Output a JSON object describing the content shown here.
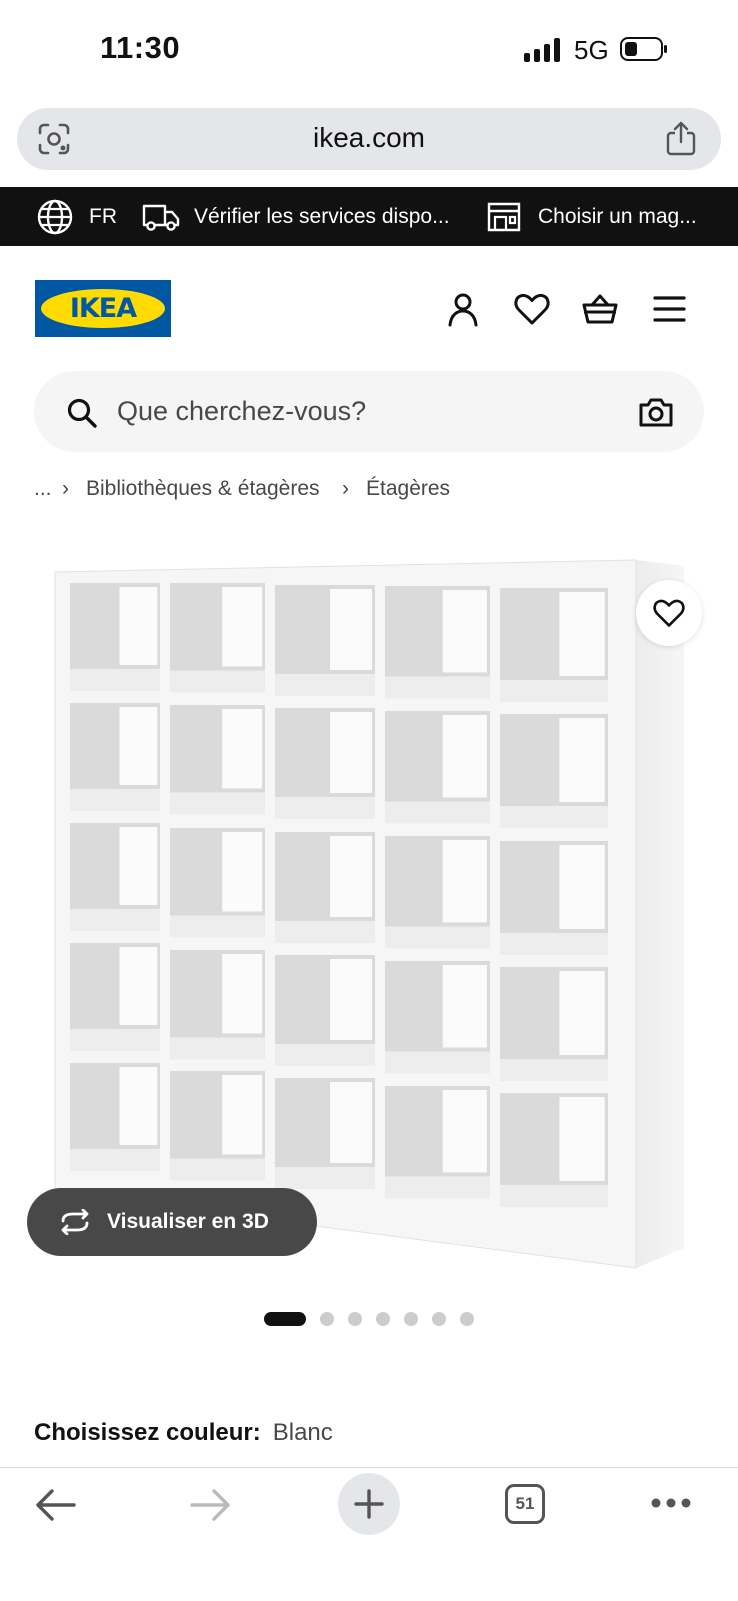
{
  "status_bar": {
    "time": "11:30",
    "network": "5G"
  },
  "browser": {
    "url": "ikea.com"
  },
  "banner": {
    "language": "FR",
    "services": "Vérifier les services dispo...",
    "store": "Choisir un mag..."
  },
  "header": {
    "logo_text": "IKEA"
  },
  "search": {
    "placeholder": "Que cherchez-vous?"
  },
  "breadcrumb": {
    "ellipsis": "...",
    "items": [
      "Bibliothèques & étagères",
      "Étagères"
    ]
  },
  "product": {
    "view_3d_label": "Visualiser en 3D",
    "image_count": 7,
    "active_image": 1
  },
  "color": {
    "label": "Choisissez couleur:",
    "value": "Blanc"
  },
  "toolbar": {
    "tab_count": "51"
  },
  "colors": {
    "brand_blue": "#0058a3",
    "brand_yellow": "#ffdb00",
    "banner_bg": "#111111"
  }
}
